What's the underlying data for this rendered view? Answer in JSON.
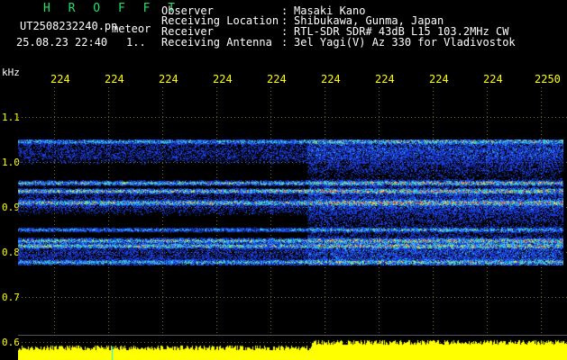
{
  "header": {
    "title": "H R O F F T",
    "filename": "UT2508232240.pn",
    "meteor_tag": "meteor",
    "datetime": "25.08.23 22:40",
    "page_marker": "1.."
  },
  "info": [
    {
      "label": "Observer",
      "value": "Masaki Kano"
    },
    {
      "label": "Receiving Location",
      "value": "Shibukawa, Gunma, Japan"
    },
    {
      "label": "Receiver",
      "value": "RTL-SDR SDR# 43dB L15 103.2MHz CW"
    },
    {
      "label": "Receiving Antenna",
      "value": "3el Yagi(V) Az 330 for Vladivostok"
    }
  ],
  "axes": {
    "y_unit": "kHz",
    "x_ticks": [
      "224",
      "224",
      "224",
      "224",
      "224",
      "224",
      "224",
      "224",
      "224",
      "2250"
    ],
    "y_ticks": [
      "1.1",
      "1.0",
      "0.9",
      "0.8",
      "0.7",
      "0.6"
    ]
  },
  "colors": {
    "background": "#000000",
    "title": "#22e06a",
    "tick_text": "#ffff00",
    "label_text": "#ffffff",
    "spectro_low": "#1a3cff",
    "spectro_high": "#ff2020",
    "signal": "#ffff00"
  }
}
